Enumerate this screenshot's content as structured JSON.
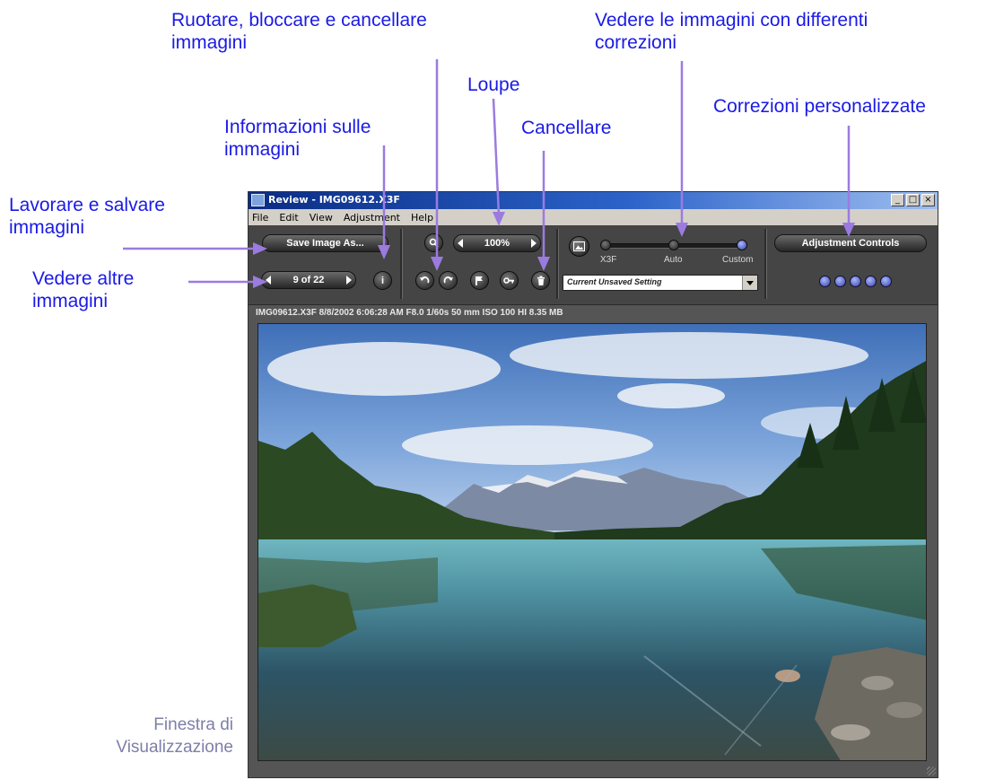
{
  "callouts": {
    "rotate": "Ruotare, bloccare e cancellare\nimmagini",
    "corrections": "Vedere le immagini con differenti\ncorrezioni",
    "loupe": "Loupe",
    "info": "Informazioni sulle\nimmagini",
    "delete": "Cancellare",
    "custom": "Correzioni personalizzate",
    "save": "Lavorare e salvare\nimmagini",
    "browse": "Vedere altre\nimmagini"
  },
  "caption": "Finestra di\nVisualizzazione",
  "window": {
    "title": "Review - IMG09612.X3F",
    "menu": [
      "File",
      "Edit",
      "View",
      "Adjustment",
      "Help"
    ],
    "controls": [
      "_",
      "□",
      "×"
    ]
  },
  "toolbar": {
    "save_label": "Save Image As...",
    "nav_counter": "9 of 22",
    "info_label": "i",
    "zoom_value": "100%",
    "adjustment_label": "Adjustment Controls",
    "slider": {
      "labels": [
        "X3F",
        "Auto",
        "Custom"
      ],
      "selected": "Custom"
    },
    "setting_dropdown": "Current Unsaved Setting",
    "preset_dot_count": 5
  },
  "image_info": "IMG09612.X3F  8/8/2002  6:06:28 AM  F8.0  1/60s  50 mm  ISO 100  HI  8.35 MB",
  "icons": [
    "window-app-icon",
    "zoom-out-icon",
    "rotate-left-icon",
    "rotate-right-icon",
    "flag-icon",
    "lock-key-icon",
    "trash-icon",
    "picture-icon",
    "resize-grip-icon"
  ],
  "colors": {
    "callout_text": "#1a1ae6",
    "arrow": "#9b7be0",
    "caption_text": "#7d7fa8",
    "toolbar_bg": "#454545",
    "title_bar": "#0a2c84",
    "active_dot": "#5a64d8"
  }
}
